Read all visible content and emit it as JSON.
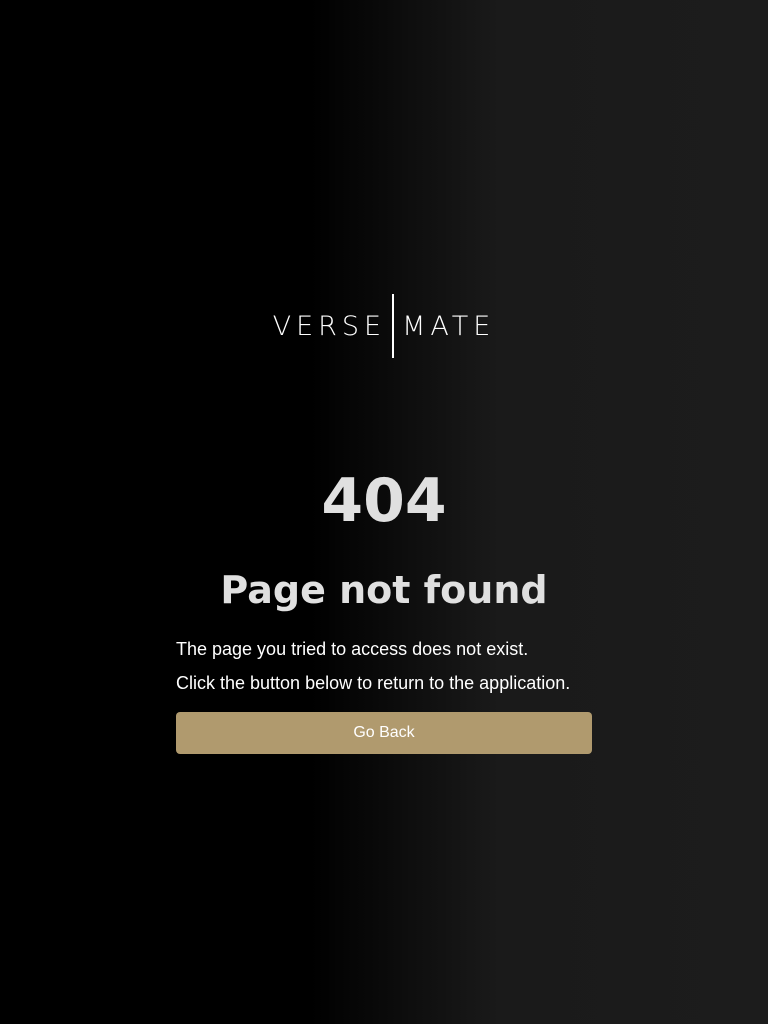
{
  "logo": {
    "left_word": "VERSE",
    "right_word": "MATE"
  },
  "error": {
    "code": "404",
    "title": "Page not found",
    "message_line_1": "The page you tried to access does not exist.",
    "message_line_2": "Click the button below to return to the application."
  },
  "actions": {
    "go_back_label": "Go Back"
  },
  "colors": {
    "background_dark": "#000000",
    "background_light": "#1c1c1c",
    "heading_text": "#e0e0e0",
    "body_text": "#ffffff",
    "button_accent": "#b09a6e"
  }
}
